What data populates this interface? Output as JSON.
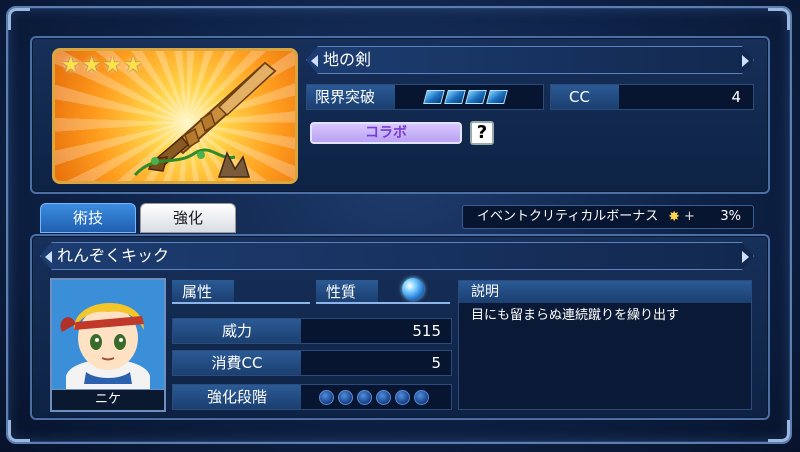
{
  "weapon": {
    "name": "地の剣",
    "rarity_stars": 4,
    "limit_break_label": "限界突破",
    "limit_break_level": 4,
    "cc_label": "CC",
    "cc_value": "4",
    "collab_label": "コラボ",
    "help_label": "?"
  },
  "tabs": [
    {
      "label": "術技",
      "active": true
    },
    {
      "label": "強化",
      "active": false
    }
  ],
  "bonus": {
    "label": "イベントクリティカルボーナス",
    "plus": "+",
    "value": "3%"
  },
  "skill": {
    "name": "れんぞくキック",
    "character_name": "ニケ",
    "attribute_label": "属性",
    "nature_label": "性質",
    "stats": [
      {
        "label": "威力",
        "value": "515"
      },
      {
        "label": "消費CC",
        "value": "5"
      },
      {
        "label": "強化段階",
        "value": ""
      }
    ],
    "enhance_level": 0,
    "enhance_max": 6,
    "description_label": "説明",
    "description": "目にも留まらぬ連続蹴りを繰り出す"
  },
  "colors": {
    "accent": "#4b6ea3",
    "tab_active": "#2f78cf",
    "collab_text": "#7a3bd8",
    "gem": "#3fa0ee"
  },
  "icons": [
    "sword-icon",
    "star-icon",
    "help-icon",
    "nature-orb-icon",
    "spark-icon"
  ]
}
